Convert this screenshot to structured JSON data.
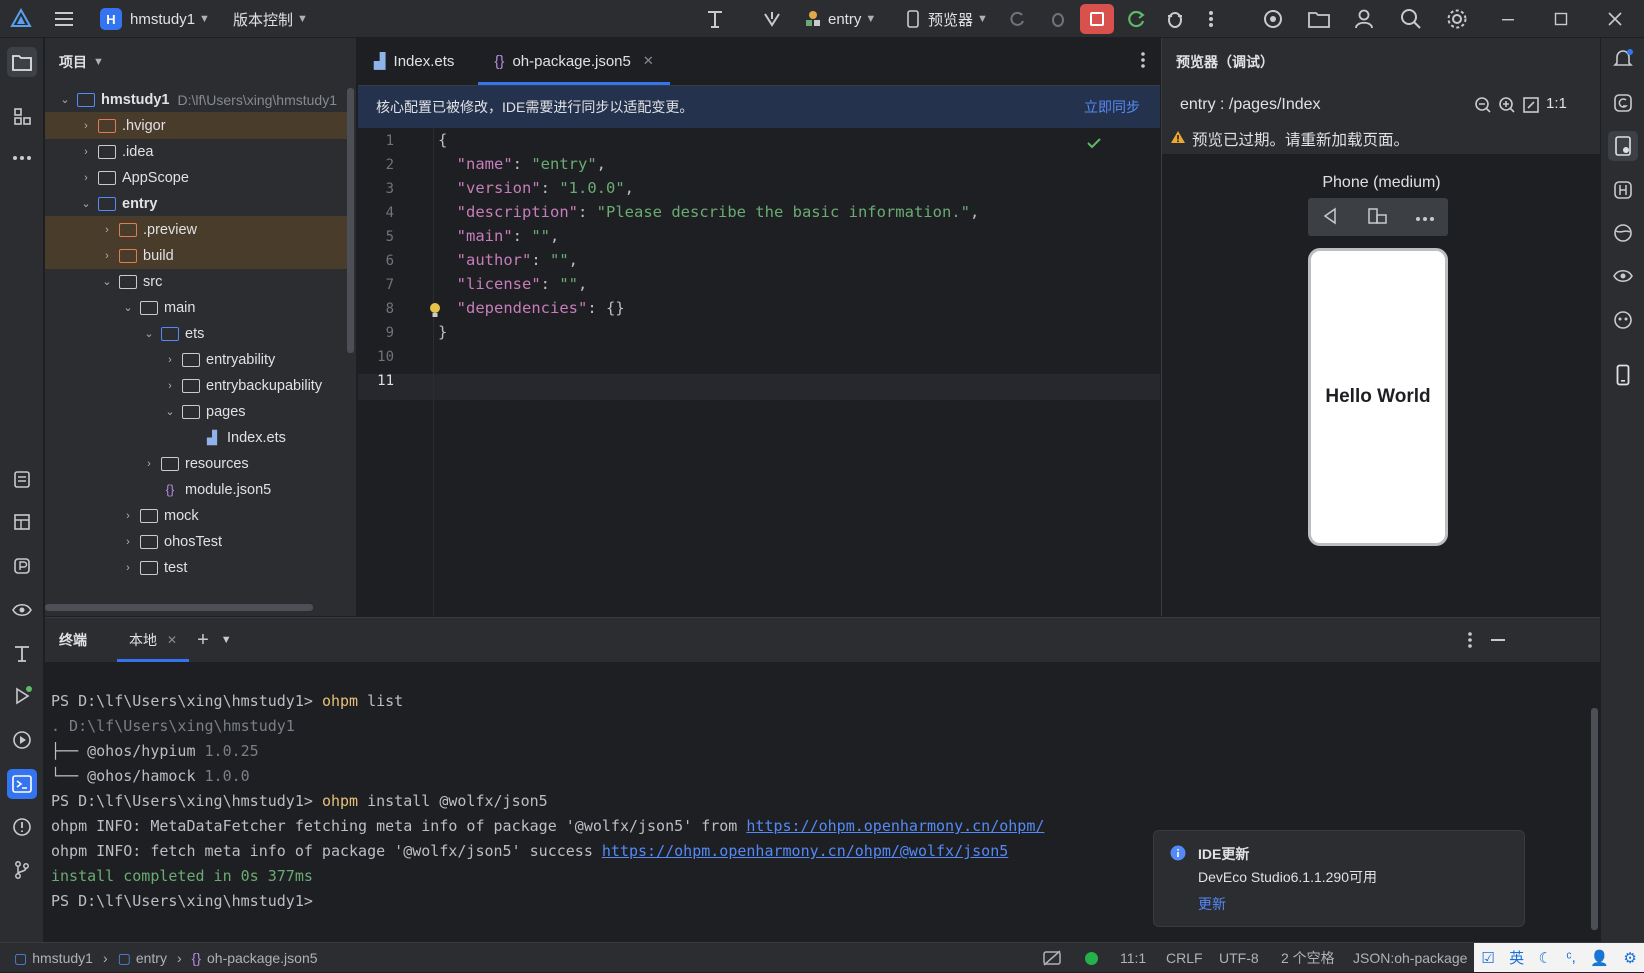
{
  "titlebar": {
    "project_name": "hmstudy1",
    "project_badge": "H",
    "vcs_label": "版本控制",
    "module": "entry",
    "device": "预览器"
  },
  "project_panel": {
    "title": "项目",
    "root": {
      "name": "hmstudy1",
      "path": "D:\\lf\\Users\\xing\\hmstudy1"
    },
    "items": [
      {
        "label": ".hvigor"
      },
      {
        "label": ".idea"
      },
      {
        "label": "AppScope"
      },
      {
        "label": "entry"
      },
      {
        "label": ".preview"
      },
      {
        "label": "build"
      },
      {
        "label": "src"
      },
      {
        "label": "main"
      },
      {
        "label": "ets"
      },
      {
        "label": "entryability"
      },
      {
        "label": "entrybackupability"
      },
      {
        "label": "pages"
      },
      {
        "label": "Index.ets"
      },
      {
        "label": "resources"
      },
      {
        "label": "module.json5"
      },
      {
        "label": "mock"
      },
      {
        "label": "ohosTest"
      },
      {
        "label": "test"
      }
    ]
  },
  "editor": {
    "tabs": [
      {
        "label": "Index.ets"
      },
      {
        "label": "oh-package.json5"
      }
    ],
    "banner_text": "核心配置已被修改，IDE需要进行同步以适配变更。",
    "banner_action": "立即同步",
    "line_numbers": [
      "1",
      "2",
      "3",
      "4",
      "5",
      "6",
      "7",
      "8",
      "9",
      "10",
      "11"
    ],
    "code": {
      "l1": "{",
      "name_key": "\"name\"",
      "name_val": "\"entry\"",
      "version_key": "\"version\"",
      "version_val": "\"1.0.0\"",
      "desc_key": "\"description\"",
      "desc_val": "\"Please describe the basic information.\"",
      "main_key": "\"main\"",
      "main_val": "\"\"",
      "author_key": "\"author\"",
      "author_val": "\"\"",
      "license_key": "\"license\"",
      "license_val": "\"\"",
      "deps_key": "\"dependencies\"",
      "deps_val": "{}",
      "l9": "}"
    }
  },
  "preview": {
    "title": "预览器（调试）",
    "route": "entry : /pages/Index",
    "zoom_label": "1:1",
    "warning": "预览已过期。请重新加载页面。",
    "device_name": "Phone (medium)",
    "phone_text": "Hello World"
  },
  "terminal": {
    "title": "终端",
    "tab_local": "本地",
    "lines": {
      "p1": "PS D:\\lf\\Users\\xing\\hmstudy1> ",
      "c1a": "ohpm",
      "c1b": " list",
      "l2": ". D:\\lf\\Users\\xing\\hmstudy1",
      "l3a": "├── @ohos/hypium ",
      "l3b": "1.0.25",
      "l4a": "└── @ohos/hamock ",
      "l4b": "1.0.0",
      "p5": "PS D:\\lf\\Users\\xing\\hmstudy1> ",
      "c5a": "ohpm",
      "c5b": " install @wolfx/json5",
      "l6a": "ohpm INFO: MetaDataFetcher fetching meta info of package '@wolfx/json5' from ",
      "l6link": "https://ohpm.openharmony.cn/ohpm/",
      "l7a": "ohpm INFO: fetch meta info of package '@wolfx/json5' success ",
      "l7link": "https://ohpm.openharmony.cn/ohpm/@wolfx/json5",
      "l8": "install completed in 0s 377ms",
      "l9": "PS D:\\lf\\Users\\xing\\hmstudy1>"
    }
  },
  "notification": {
    "title": "IDE更新",
    "body": "DevEco Studio6.1.1.290可用",
    "action": "更新"
  },
  "statusbar": {
    "crumbs": [
      "hmstudy1",
      "entry",
      "oh-package.json5"
    ],
    "position": "11:1",
    "line_sep": "CRLF",
    "encoding": "UTF-8",
    "indent": "2 个空格",
    "file_type": "JSON:oh-package",
    "ime_lang": "英"
  }
}
